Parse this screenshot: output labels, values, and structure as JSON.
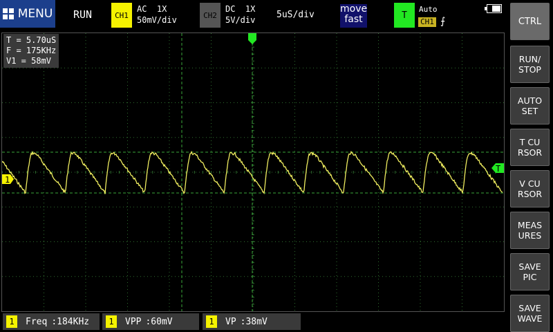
{
  "top_bar": {
    "menu_label": "MENU",
    "run_state": "RUN",
    "ch1": {
      "tag": "CH1",
      "coupling": "AC  1X",
      "scale": "50mV/div",
      "color": "#f5f200"
    },
    "ch2": {
      "tag": "CH2",
      "coupling": "DC  1X",
      "scale": "5V/div",
      "color": "#555555"
    },
    "timebase": "5uS/div",
    "move_line1": "move",
    "move_line2": "fast",
    "trigger": {
      "tag": "T",
      "mode": "Auto",
      "source": "CH1",
      "edge": "⨍",
      "color": "#22e822"
    }
  },
  "readout": {
    "period": "T = 5.70uS",
    "frequency": "F = 175KHz",
    "v1": "V1 = 58mV"
  },
  "markers": {
    "ch1_marker": "1",
    "trigger_level_marker": "T"
  },
  "side_buttons": [
    {
      "label": "CTRL",
      "active": true
    },
    {
      "label": "RUN/\nSTOP",
      "active": false
    },
    {
      "label": "AUTO\nSET",
      "active": false
    },
    {
      "label": "T CU\nRSOR",
      "active": false
    },
    {
      "label": "V CU\nRSOR",
      "active": false
    },
    {
      "label": "MEAS\nURES",
      "active": false
    },
    {
      "label": "SAVE\nPIC",
      "active": false
    },
    {
      "label": "SAVE\nWAVE",
      "active": false
    }
  ],
  "measurements": [
    {
      "badge": "1",
      "label": "Freq",
      "value": ":184KHz"
    },
    {
      "badge": "1",
      "label": "VPP",
      "value": ":60mV"
    },
    {
      "badge": "1",
      "label": "VP",
      "value": ":38mV"
    }
  ],
  "colors": {
    "trace": "#f0ee60",
    "grid": "#2f6f2f",
    "cursor": "#3aa83a",
    "menu_bg": "#1c3f8c"
  }
}
